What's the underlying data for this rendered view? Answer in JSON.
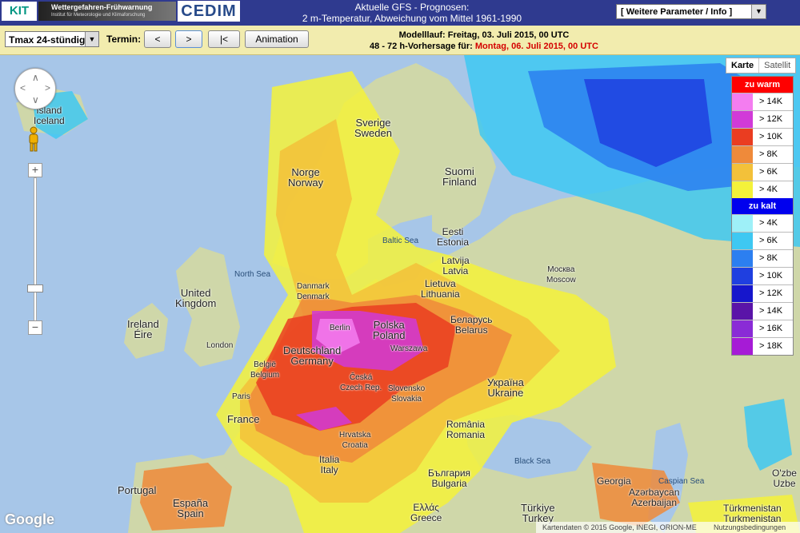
{
  "header": {
    "logo_kit": "KIT",
    "logo_wfw_title": "Wettergefahren-Frühwarnung",
    "logo_wfw_subtitle": "Institut für Meteorologie und Klimaforschung",
    "logo_cedim": "CEDIM",
    "title_line1": "Aktuelle GFS - Prognosen:",
    "title_line2": "2 m-Temperatur, Abweichung vom Mittel 1961-1990",
    "param_select": "[ Weitere Parameter / Info ]"
  },
  "toolbar": {
    "tmax_select": "Tmax 24-stündig",
    "termin_label": "Termin:",
    "btn_prev": "<",
    "btn_next": ">",
    "btn_first": "|<",
    "btn_animation": "Animation",
    "model_run": "Modelllauf: Freitag, 03. Juli 2015, 00 UTC",
    "forecast_prefix": "48 - 72 h-Vorhersage für:",
    "forecast_date": "Montag, 06. Juli 2015, 00 UTC"
  },
  "maptype": {
    "map": "Karte",
    "satellite": "Satellit"
  },
  "legend": {
    "warm_title": "zu warm",
    "cold_title": "zu kalt",
    "warm_color": "#ff0000",
    "cold_color": "#0000ee",
    "warm": [
      {
        "label": "> 14K",
        "color": "#f47df0"
      },
      {
        "label": "> 12K",
        "color": "#d13ad8"
      },
      {
        "label": "> 10K",
        "color": "#ea3d21"
      },
      {
        "label": "> 8K",
        "color": "#ef8a3a"
      },
      {
        "label": "> 6K",
        "color": "#f3c13a"
      },
      {
        "label": "> 4K",
        "color": "#f4f23a"
      }
    ],
    "cold": [
      {
        "label": "> 4K",
        "color": "#9ef0f8"
      },
      {
        "label": "> 6K",
        "color": "#3ec8f2"
      },
      {
        "label": "> 8K",
        "color": "#2c7ff0"
      },
      {
        "label": "> 10K",
        "color": "#1f3fe0"
      },
      {
        "label": "> 12K",
        "color": "#1616cc"
      },
      {
        "label": "> 14K",
        "color": "#5a14a8"
      },
      {
        "label": "> 16K",
        "color": "#8a2bd6"
      },
      {
        "label": "> 18K",
        "color": "#a61bd6"
      }
    ]
  },
  "places": {
    "island": "Ísland",
    "iceland": "Iceland",
    "sverige": "Sverige",
    "sweden": "Sweden",
    "norge": "Norge",
    "norway": "Norway",
    "suomi": "Suomi",
    "finland": "Finland",
    "eesti": "Eesti",
    "estonia": "Estonia",
    "latvija": "Latvija",
    "latvia": "Latvia",
    "lietuva": "Lietuva",
    "lithuania": "Lithuania",
    "moskva": "Москва",
    "moscow": "Moscow",
    "belarus_cyr": "Беларусь",
    "belarus": "Belarus",
    "polska": "Polska",
    "poland": "Poland",
    "warszawa": "Warszawa",
    "deutschland": "Deutschland",
    "germany": "Germany",
    "berlin": "Berlin",
    "danmark": "Danmark",
    "denmark": "Denmark",
    "uk1": "United",
    "uk2": "Kingdom",
    "london": "London",
    "ireland": "Ireland",
    "eire": "Éire",
    "belgie": "België",
    "belgium": "Belgium",
    "paris": "Paris",
    "france": "France",
    "ceska": "Česká",
    "czech": "Czech Rep.",
    "slovensko": "Slovensko",
    "slovakia": "Slovakia",
    "ukraina_cyr": "Україна",
    "ukraine": "Ukraine",
    "hrvatska": "Hrvatska",
    "croatia": "Croatia",
    "romania": "România",
    "romania_en": "Romania",
    "bulgaria_cyr": "България",
    "bulgaria": "Bulgaria",
    "italia": "Italia",
    "italy": "Italy",
    "portugal": "Portugal",
    "espana": "España",
    "spain": "Spain",
    "ellas": "Ελλάς",
    "greece": "Greece",
    "turkiye": "Türkiye",
    "turkey": "Turkey",
    "georgia": "Georgia",
    "azerbaijan": "Azerbaijan",
    "azerbaycan": "Azərbaycan",
    "turkmenistan": "Türkmenistan",
    "turkmenistan2": "Turkmenistan",
    "ozbe": "O'zbe",
    "uzbe": "Uzbe"
  },
  "seas": {
    "north_sea": "North Sea",
    "baltic_sea": "Baltic Sea",
    "black_sea": "Black Sea",
    "caspian_sea": "Caspian Sea"
  },
  "footer": {
    "attribution": "Kartendaten © 2015 Google, INEGI, ORION-ME",
    "terms": "Nutzungsbedingungen",
    "google": "Google"
  }
}
